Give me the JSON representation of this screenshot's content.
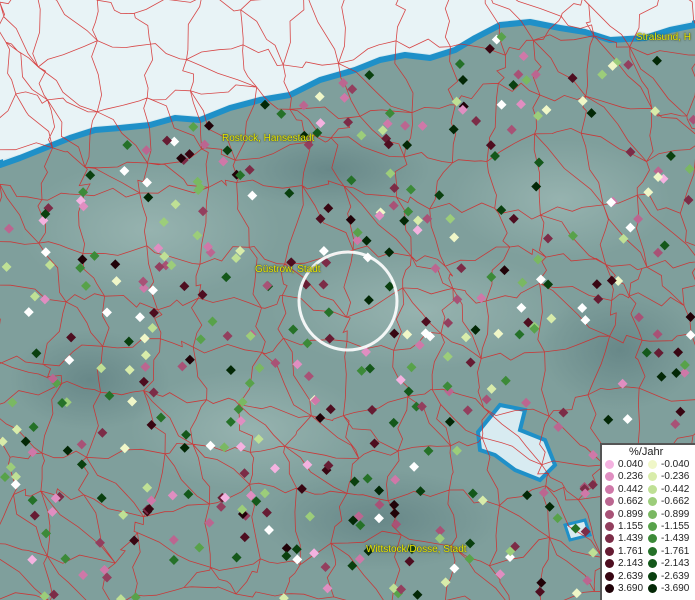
{
  "legend": {
    "title": "%/Jahr",
    "positive": [
      {
        "label": "0.040",
        "color": "#f4b2e0"
      },
      {
        "label": "0.236",
        "color": "#e08ec1"
      },
      {
        "label": "0.442",
        "color": "#cf78a8"
      },
      {
        "label": "0.662",
        "color": "#bb6690"
      },
      {
        "label": "0.899",
        "color": "#a85276"
      },
      {
        "label": "1.155",
        "color": "#933f5e"
      },
      {
        "label": "1.439",
        "color": "#7c2c47"
      },
      {
        "label": "1.761",
        "color": "#661c33"
      },
      {
        "label": "2.143",
        "color": "#4e0e20"
      },
      {
        "label": "2.639",
        "color": "#380612"
      },
      {
        "label": "3.690",
        "color": "#200208"
      }
    ],
    "negative": [
      {
        "label": "-0.040",
        "color": "#f0f7c8"
      },
      {
        "label": "-0.236",
        "color": "#d8ecaa"
      },
      {
        "label": "-0.442",
        "color": "#bfe095"
      },
      {
        "label": "-0.662",
        "color": "#9ccd7a"
      },
      {
        "label": "-0.899",
        "color": "#7ab862"
      },
      {
        "label": "-1.155",
        "color": "#58a24a"
      },
      {
        "label": "-1.439",
        "color": "#3c8a38"
      },
      {
        "label": "-1.761",
        "color": "#257128"
      },
      {
        "label": "-2.143",
        "color": "#14581a"
      },
      {
        "label": "-2.639",
        "color": "#0a400f"
      },
      {
        "label": "-3.690",
        "color": "#032806"
      }
    ]
  },
  "cities": [
    {
      "name": "Rostock, Hansestadt"
    },
    {
      "name": "Stralsund, H"
    },
    {
      "name": "Güstrow, Stadt"
    },
    {
      "name": "Wittstock/Dosse, Stadt"
    }
  ],
  "colors": {
    "land": "#7f9f9c",
    "sea": "#d6eaf0",
    "water": "#1f90c8",
    "border": "#d42828",
    "selection": "#ffffff"
  }
}
